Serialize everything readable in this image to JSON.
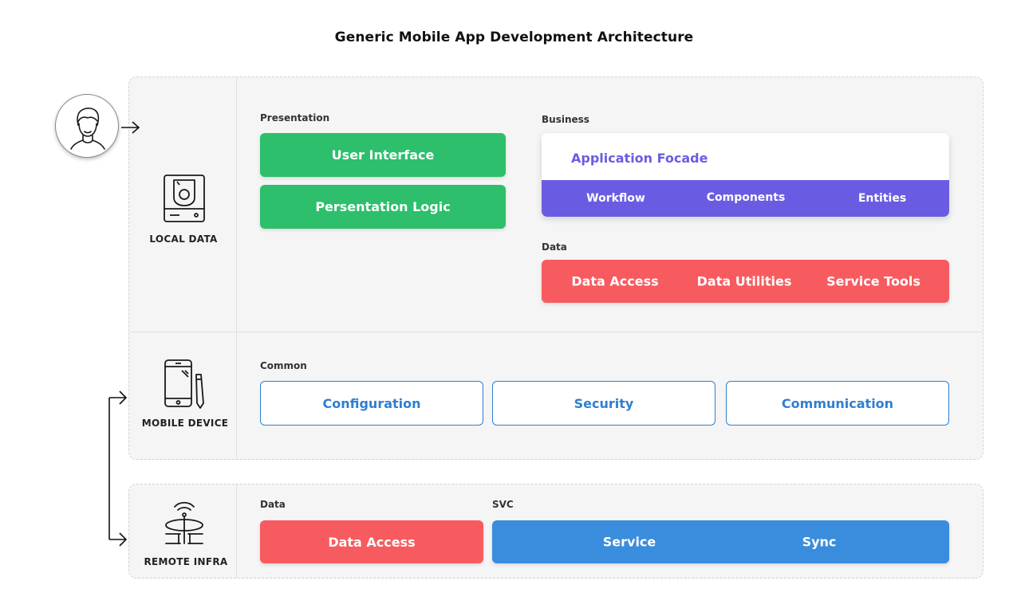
{
  "title": "Generic Mobile App Development Architecture",
  "rows": {
    "local_data": "LOCAL DATA",
    "mobile_device": "MOBILE DEVICE",
    "remote_infra": "REMOTE INFRA"
  },
  "presentation": {
    "label": "Presentation",
    "user_interface": "User Interface",
    "presentation_logic": "Persentation Logic"
  },
  "business": {
    "label": "Business",
    "facade": "Application Focade",
    "items": [
      "Workflow",
      "Components",
      "Entities"
    ]
  },
  "data_top": {
    "label": "Data",
    "items": [
      "Data Access",
      "Data Utilities",
      "Service Tools"
    ]
  },
  "common": {
    "label": "Common",
    "items": [
      "Configuration",
      "Security",
      "Communication"
    ]
  },
  "remote_data": {
    "label": "Data",
    "item": "Data Access"
  },
  "svc": {
    "label": "SVC",
    "items": [
      "Service",
      "Sync"
    ]
  },
  "colors": {
    "green": "#2dbf6c",
    "red": "#f75b5f",
    "blue": "#3a8ddc",
    "purple": "#6a5ce2",
    "outline_blue": "#2f7fd0",
    "panel": "#f5f5f5"
  }
}
